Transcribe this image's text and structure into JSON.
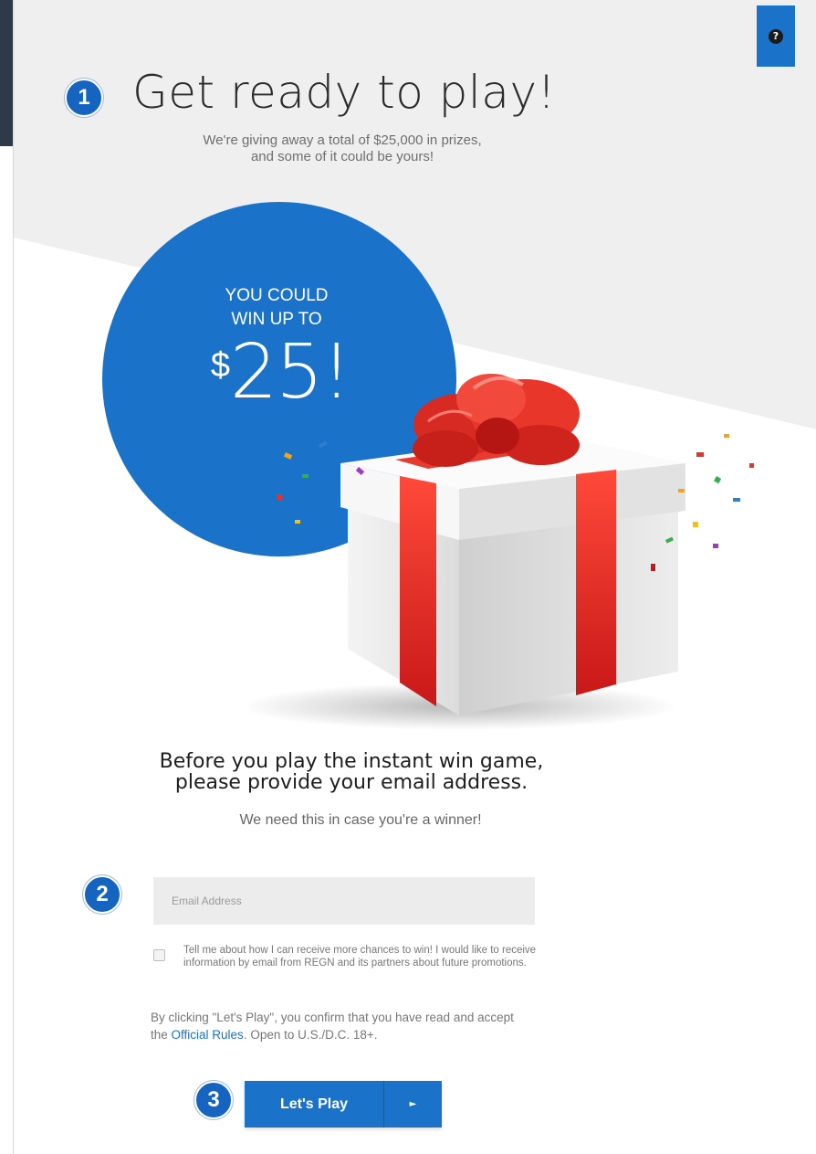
{
  "colors": {
    "accent": "#1a73c9",
    "badge": "#1565c0",
    "top_band": "#2f3a48",
    "panel_gray": "#efefef",
    "ribbon_red": "#e62c2c"
  },
  "help_button": {
    "icon": "question-circle-icon",
    "glyph": "?"
  },
  "badges": [
    "1",
    "2",
    "3"
  ],
  "header": {
    "title": "Get ready to play!",
    "subtitle_line1": "We're giving away a total of $25,000 in prizes,",
    "subtitle_line2": "and some of it could be yours!"
  },
  "prize": {
    "line1": "YOU COULD",
    "line2": "WIN UP TO",
    "currency": "$",
    "amount": "25!"
  },
  "form": {
    "intro_line1": "Before you play the instant win game,",
    "intro_line2": "please provide your email address.",
    "note": "We need this in case you're a winner!",
    "email_placeholder": "Email Address",
    "email_value": "",
    "opt_in_checked": false,
    "opt_in_text": "Tell me about how I can receive more chances to win! I would like to receive information by email from REGN and its partners about future promotions.",
    "terms_before": "By clicking \"Let's Play\", you confirm that you have read and accept the ",
    "terms_link": "Official Rules",
    "terms_after": ". Open to U.S./D.C. 18+.",
    "play_label": "Let's Play",
    "play_arrow": "►"
  }
}
